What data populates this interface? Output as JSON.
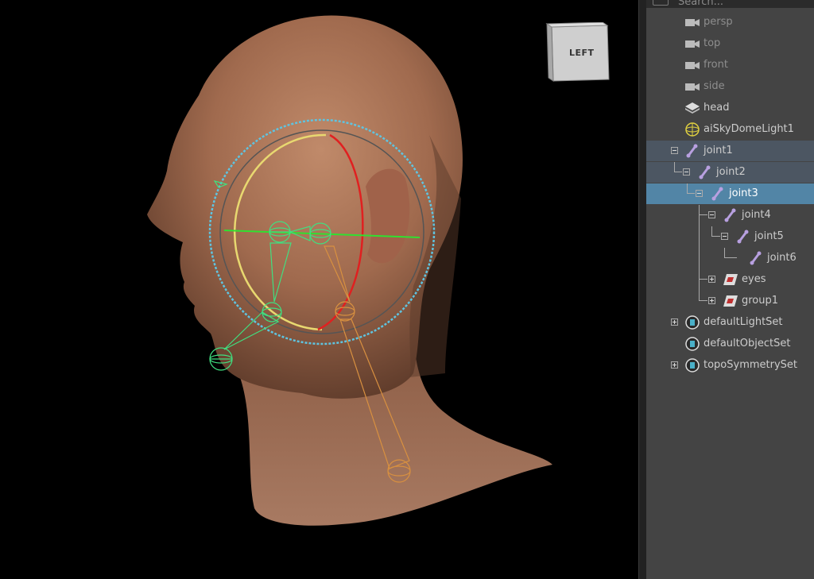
{
  "viewport": {
    "view_cube_label": "LEFT"
  },
  "outliner": {
    "search_placeholder": "Search...",
    "items": [
      {
        "label": "persp",
        "type": "camera"
      },
      {
        "label": "top",
        "type": "camera"
      },
      {
        "label": "front",
        "type": "camera"
      },
      {
        "label": "side",
        "type": "camera"
      },
      {
        "label": "head",
        "type": "mesh"
      },
      {
        "label": "aiSkyDomeLight1",
        "type": "light"
      },
      {
        "label": "joint1",
        "type": "joint"
      },
      {
        "label": "joint2",
        "type": "joint"
      },
      {
        "label": "joint3",
        "type": "joint"
      },
      {
        "label": "joint4",
        "type": "joint"
      },
      {
        "label": "joint5",
        "type": "joint"
      },
      {
        "label": "joint6",
        "type": "joint"
      },
      {
        "label": "eyes",
        "type": "group"
      },
      {
        "label": "group1",
        "type": "group"
      },
      {
        "label": "defaultLightSet",
        "type": "set"
      },
      {
        "label": "defaultObjectSet",
        "type": "set"
      },
      {
        "label": "topoSymmetrySet",
        "type": "set"
      }
    ]
  },
  "colors": {
    "selection": "#5285a6",
    "selection_dim": "#4c5662",
    "panel_bg": "#444444",
    "joint_icon": "#b8a0e0"
  }
}
